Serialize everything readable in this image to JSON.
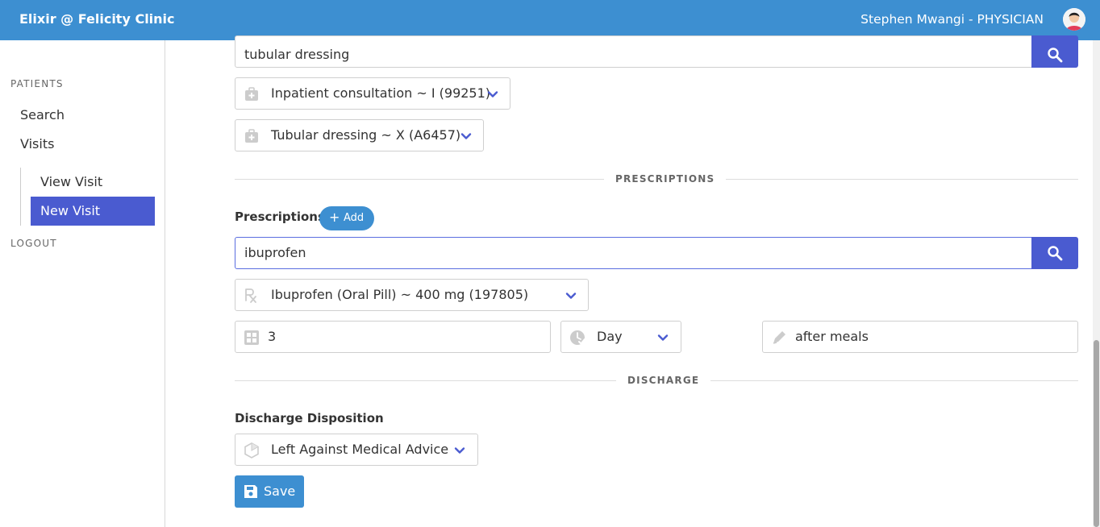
{
  "header": {
    "brand": "Elixir @ Felicity Clinic",
    "user": "Stephen Mwangi - PHYSICIAN"
  },
  "sidebar": {
    "patients_section": "PATIENTS",
    "search": "Search",
    "visits": "Visits",
    "view_visit": "View Visit",
    "new_visit": "New Visit",
    "logout": "LOGOUT"
  },
  "procedures": {
    "search_value": "tubular dressing",
    "items": [
      {
        "label": "Inpatient consultation ~ I (99251)",
        "icon": "medkit-icon"
      },
      {
        "label": "Tubular dressing ~ X (A6457)",
        "icon": "medkit-icon"
      }
    ]
  },
  "prescriptions": {
    "section_label": "PRESCRIPTIONS",
    "heading": "Prescriptions",
    "add_label": "Add",
    "search_value": "ibuprofen",
    "drug": "Ibuprofen (Oral Pill) ~ 400 mg (197805)",
    "quantity": "3",
    "frequency": "Day",
    "instructions": "after meals"
  },
  "discharge": {
    "section_label": "DISCHARGE",
    "heading": "Discharge Disposition",
    "value": "Left Against Medical Advice"
  },
  "actions": {
    "save_label": "Save"
  },
  "colors": {
    "primary": "#3d8fd1",
    "accent": "#4a5bd0"
  }
}
